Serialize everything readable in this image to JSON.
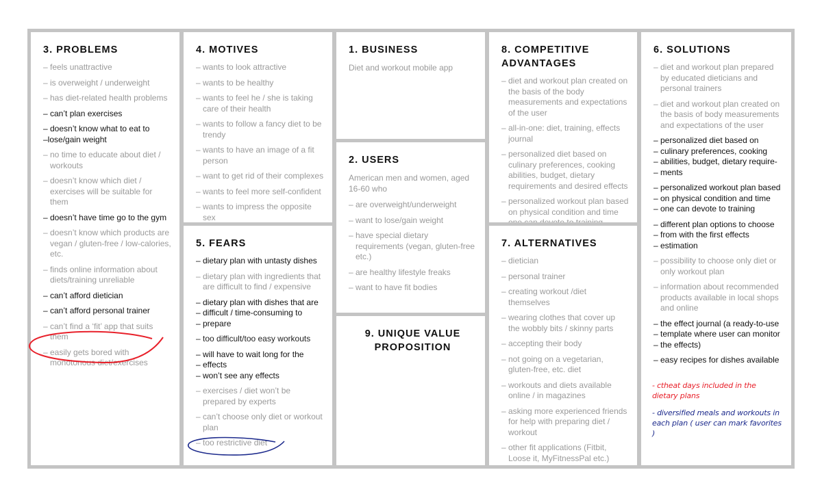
{
  "colors": {
    "orange": "#ffb74d",
    "green": "#a8ff7a",
    "yellow": "#e6ff1a",
    "red_note": "#e8202a",
    "blue_note": "#1c2a8c"
  },
  "sections": {
    "problems": {
      "title": "3. PROBLEMS",
      "items": [
        {
          "text": "– feels unattractive"
        },
        {
          "text": "– is overweight / underweight"
        },
        {
          "text": "– has diet-related health problems"
        },
        {
          "text": "– can’t plan exercises",
          "hl": "orange"
        },
        {
          "text": "– doesn’t know what to eat to",
          "hl": "green"
        },
        {
          "text": "–lose/gain weight",
          "hl": "green"
        },
        {
          "text": "– no time to educate about diet / workouts"
        },
        {
          "text": "– doesn’t know which diet / exercises will be suitable for them"
        },
        {
          "text": "– doesn’t have time go to the gym",
          "hl": "orange"
        },
        {
          "text": "– doesn’t know which products are vegan / gluten-free / low-calories, etc."
        },
        {
          "text": "– finds online information about diets/training unreliable"
        },
        {
          "text": "– can’t afford dietician",
          "hl": "green"
        },
        {
          "text": "– can’t afford personal trainer",
          "hl": "orange"
        },
        {
          "text": "– can’t find a ‘fit’ app that suits them"
        },
        {
          "text": "– easily gets bored with monotonous diet/exercises",
          "circled": "red"
        }
      ]
    },
    "motives": {
      "title": "4. MOTIVES",
      "items": [
        {
          "text": "– wants to look attractive"
        },
        {
          "text": "– wants to be healthy"
        },
        {
          "text": "– wants to feel he / she is taking care of their health"
        },
        {
          "text": "– wants to follow a fancy diet to be trendy"
        },
        {
          "text": "– wants to have an image of a fit person"
        },
        {
          "text": "– want to get rid of their complexes"
        },
        {
          "text": "– wants to feel more self-confident"
        },
        {
          "text": "– wants to impress the opposite sex"
        }
      ]
    },
    "fears": {
      "title": "5. FEARS",
      "items": [
        {
          "text": "– dietary plan with untasty dishes",
          "hl": "green"
        },
        {
          "text": "– dietary plan with ingredients that are difficult to find / expensive"
        },
        {
          "text": "– dietary plan with dishes that are",
          "hl": "green"
        },
        {
          "text": "– difficult / time-consuming to",
          "hl": "green"
        },
        {
          "text": "– prepare",
          "hl": "green"
        },
        {
          "text": "– too difficult/too easy workouts",
          "dark": true
        },
        {
          "text": "– will have to wait long for the",
          "hl": "yellow"
        },
        {
          "text": "– effects",
          "hl": "yellow"
        },
        {
          "text": "– won’t see any effects",
          "hl": "yellow"
        },
        {
          "text": "– exercises / diet won’t be prepared by experts"
        },
        {
          "text": "– can’t choose only diet or workout plan"
        },
        {
          "text": "– too restrictive diet",
          "circled": "blue"
        }
      ]
    },
    "business": {
      "title": "1. BUSINESS",
      "description": "Diet and workout mobile app"
    },
    "users": {
      "title": "2. USERS",
      "description": "American men and women, aged 16-60 who",
      "items": [
        {
          "text": "–  are overweight/underweight"
        },
        {
          "text": "–  want to lose/gain weight"
        },
        {
          "text": "–  have special dietary requirements (vegan, gluten-free etc.)"
        },
        {
          "text": "–  are healthy lifestyle freaks"
        },
        {
          "text": "–  want to have fit bodies"
        }
      ]
    },
    "uvp": {
      "title": "9. UNIQUE VALUE PROPOSITION"
    },
    "competitive": {
      "title": "8. COMPETITIVE ADVANTAGES",
      "items": [
        {
          "text": "– diet and workout plan created on the basis of the body measurements and expectations of the user"
        },
        {
          "text": "– all-in-one: diet, training, effects journal"
        },
        {
          "text": "– personalized diet based on culinary preferences, cooking abilities, budget, dietary requirements and desired effects"
        },
        {
          "text": "– personalized workout plan based on physical condition and time one can devote to training"
        }
      ]
    },
    "alternatives": {
      "title": "7. ALTERNATIVES",
      "items": [
        {
          "text": "– dietician"
        },
        {
          "text": "– personal trainer"
        },
        {
          "text": "– creating  workout /diet themselves"
        },
        {
          "text": "– wearing clothes that cover up the wobbly bits / skinny parts"
        },
        {
          "text": "– accepting their body"
        },
        {
          "text": "– not going on a vegetarian, gluten-free, etc. diet"
        },
        {
          "text": "– workouts and diets available online / in magazines"
        },
        {
          "text": "– asking more experienced friends for help with preparing diet / workout"
        },
        {
          "text": "– other fit applications (Fitbit, Loose it, MyFitnessPal etc.)"
        }
      ]
    },
    "solutions": {
      "title": "6. SOLUTIONS",
      "items": [
        {
          "text": "– diet and workout plan prepared by educated dieticians and personal trainers"
        },
        {
          "text": "– diet and workout plan created on the basis of body measurements and expectations of the user"
        },
        {
          "text": "– personalized diet based on",
          "hl": "green"
        },
        {
          "text": "– culinary preferences, cooking",
          "hl": "green"
        },
        {
          "text": "– abilities, budget, dietary require-",
          "hl": "green"
        },
        {
          "text": "– ments",
          "hl": "green"
        },
        {
          "text": "– personalized workout plan based",
          "hl": "orange"
        },
        {
          "text": "– on physical condition and time",
          "hl": "orange"
        },
        {
          "text": "– one can devote to training",
          "hl": "orange"
        },
        {
          "text": "– different plan options to choose",
          "hl": "yellow"
        },
        {
          "text": "– from with the first effects",
          "hl": "yellow"
        },
        {
          "text": "– estimation",
          "hl": "yellow"
        },
        {
          "text": "– possibility to choose only diet or only workout plan"
        },
        {
          "text": "– information about recommended products available in local shops and online"
        },
        {
          "text": "– the effect journal (a ready-to-use",
          "hl": "yellow"
        },
        {
          "text": "– template where user can monitor",
          "hl": "yellow"
        },
        {
          "text": "– the effects)",
          "hl": "yellow"
        },
        {
          "text": "– easy recipes for dishes available",
          "hl": "green"
        }
      ],
      "notes": [
        {
          "text": "- ctheat days included in the dietary plans",
          "color": "red"
        },
        {
          "text": "- diversified meals and workouts in each plan ( user can mark favorites )",
          "color": "blue"
        }
      ]
    }
  }
}
